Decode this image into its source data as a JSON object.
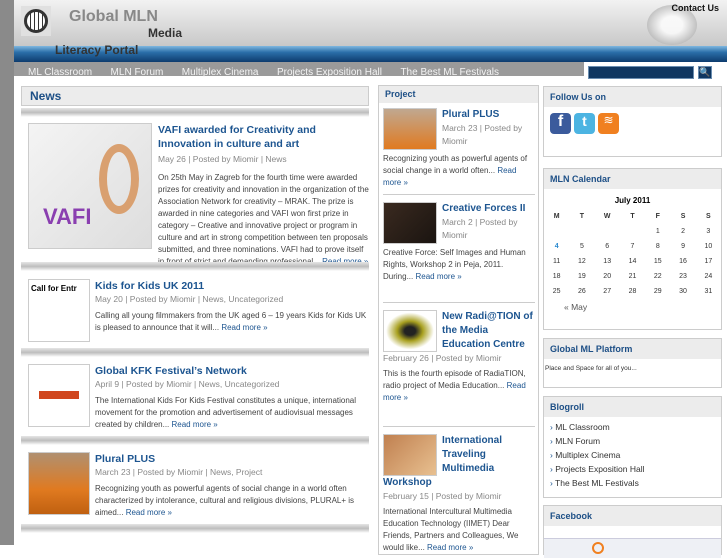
{
  "header": {
    "title1": "Global MLN",
    "title2": "Media",
    "title3": "Literacy Portal",
    "contact": "Contact Us"
  },
  "nav": [
    "ML Classroom",
    "MLN Forum",
    "Multiplex Cinema",
    "Projects Exposition Hall",
    "The Best ML Festivals"
  ],
  "search": {
    "button": "🔍"
  },
  "news": {
    "heading": "News",
    "posts": [
      {
        "title": "VAFI awarded for Creativity and Innovation in culture and art",
        "meta": "May 26 | Posted by Miomir | News",
        "excerpt": "On 25th May in Zagreb for the fourth time were awarded prizes for creativity and innovation in the organization of the Association Network for creativity – MRAK. The prize is awarded in nine categories and VAFI won first prize in category – Creative and innovative project or program in culture and art in strong competition between ten proposals submitted, and three nominations. VAFI had to prove itself in front of strict and demanding professional...",
        "more": "Read more »"
      },
      {
        "title": "Kids for Kids UK 2011",
        "meta": "May 20 | Posted by Miomir | News, Uncategorized",
        "excerpt": "Calling all young filmmakers from the UK aged 6 – 19 years Kids for Kids UK is pleased to announce that it will...",
        "more": "Read more »",
        "thumb": "Call for Entr"
      },
      {
        "title": "Global KFK Festival’s Network",
        "meta": "April 9 | Posted by Miomir | News, Uncategorized",
        "excerpt": "The International Kids For Kids Festival constitutes a unique, international movement for the promotion and advertisement of audiovisual messages created by children...",
        "more": "Read more »"
      },
      {
        "title": "Plural PLUS",
        "meta": "March 23 | Posted by Miomir | News, Project",
        "excerpt": "Recognizing youth as powerful agents of social change in a world often characterized by intolerance, cultural and religious divisions, PLURAL+ is aimed...",
        "more": "Read more »"
      }
    ]
  },
  "project": {
    "heading": "Project",
    "posts": [
      {
        "title": "Plural PLUS",
        "meta": "March 23 | Posted by Miomir",
        "excerpt": "Recognizing youth as powerful agents of social change in a world often...",
        "more": "Read more »"
      },
      {
        "title": "Creative Forces II",
        "meta": "March 2 | Posted by Miomir",
        "excerpt": "Creative Force: Self Images and Human Rights, Workshop 2 in Peja, 2011. During...",
        "more": "Read more »"
      },
      {
        "title": "New Radi@TION of the Media Education Centre",
        "meta": "February 26 | Posted by Miomir",
        "excerpt": "This is the fourth episode of RadiaTION, radio project of Media Education...",
        "more": "Read more »"
      },
      {
        "title": "International Traveling Multimedia Workshop",
        "meta": "February 15 | Posted by Miomir",
        "excerpt": "International Intercultural Multimedia Education Technology (IIMET) Dear Friends, Partners and Colleagues, We would like...",
        "more": "Read more »"
      }
    ]
  },
  "sidebar": {
    "follow": "Follow Us on",
    "calendar": {
      "heading": "MLN Calendar",
      "month": "July 2011",
      "days": [
        "M",
        "T",
        "W",
        "T",
        "F",
        "S",
        "S"
      ],
      "weeks": [
        [
          "",
          "",
          "",
          "",
          "1",
          "2",
          "3"
        ],
        [
          "4",
          "5",
          "6",
          "7",
          "8",
          "9",
          "10"
        ],
        [
          "11",
          "12",
          "13",
          "14",
          "15",
          "16",
          "17"
        ],
        [
          "18",
          "19",
          "20",
          "21",
          "22",
          "23",
          "24"
        ],
        [
          "25",
          "26",
          "27",
          "28",
          "29",
          "30",
          "31"
        ]
      ],
      "today": "4",
      "prev": "« May"
    },
    "platform": {
      "heading": "Global ML Platform",
      "text": "Place and Space for all of you..."
    },
    "blogroll": {
      "heading": "Blogroll",
      "items": [
        "ML Classroom",
        "MLN Forum",
        "Multiplex Cinema",
        "Projects Exposition Hall",
        "The Best ML Festivals"
      ]
    },
    "facebook": {
      "heading": "Facebook"
    }
  },
  "colors": {
    "accent": "#1d5590",
    "band": "#2a6ea8"
  }
}
